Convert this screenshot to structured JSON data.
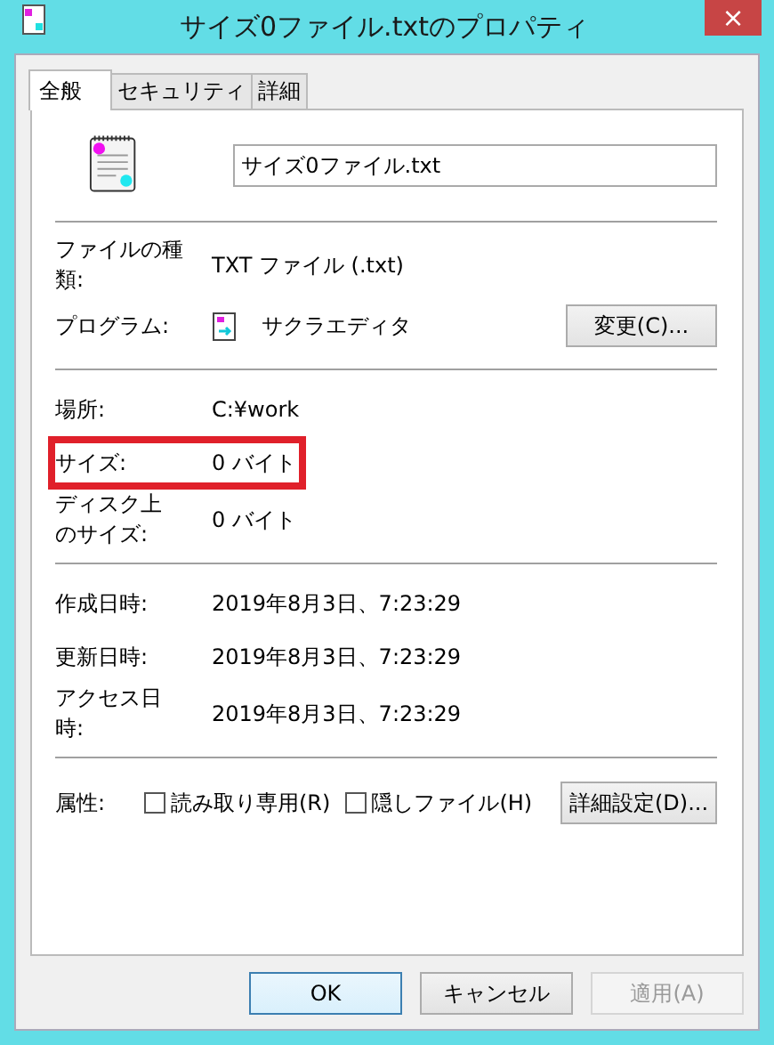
{
  "window": {
    "title": "サイズ0ファイル.txtのプロパティ",
    "close": "×"
  },
  "tabs": [
    {
      "label": "全般",
      "selected": true
    },
    {
      "label": "セキュリティ",
      "selected": false
    },
    {
      "label": "詳細",
      "selected": false
    }
  ],
  "file_name": "サイズ0ファイル.txt",
  "sections": [
    [
      {
        "kind": "text",
        "label": "ファイルの種類:",
        "value": "TXT ファイル (.txt)"
      },
      {
        "kind": "program",
        "label": "プログラム:",
        "value": "サクラエディタ",
        "button": "変更(C)..."
      }
    ],
    [
      {
        "kind": "text",
        "label": "場所:",
        "value": "C:¥work"
      },
      {
        "kind": "text",
        "label": "サイズ:",
        "value": "0 バイト",
        "highlighted": true
      },
      {
        "kind": "text",
        "label": "ディスク上のサイズ:",
        "value": "0 バイト"
      }
    ],
    [
      {
        "kind": "text",
        "label": "作成日時:",
        "value": "2019年8月3日、7:23:29"
      },
      {
        "kind": "text",
        "label": "更新日時:",
        "value": "2019年8月3日、7:23:29"
      },
      {
        "kind": "text",
        "label": "アクセス日時:",
        "value": "2019年8月3日、7:23:29"
      }
    ],
    [
      {
        "kind": "attributes",
        "label": "属性:",
        "checkboxes": [
          {
            "label": "読み取り専用(R)",
            "checked": false
          },
          {
            "label": "隠しファイル(H)",
            "checked": false
          }
        ],
        "button": "詳細設定(D)..."
      }
    ]
  ],
  "buttons": [
    {
      "label": "OK",
      "default": true,
      "disabled": false
    },
    {
      "label": "キャンセル",
      "default": false,
      "disabled": false
    },
    {
      "label": "適用(A)",
      "default": false,
      "disabled": true
    }
  ]
}
